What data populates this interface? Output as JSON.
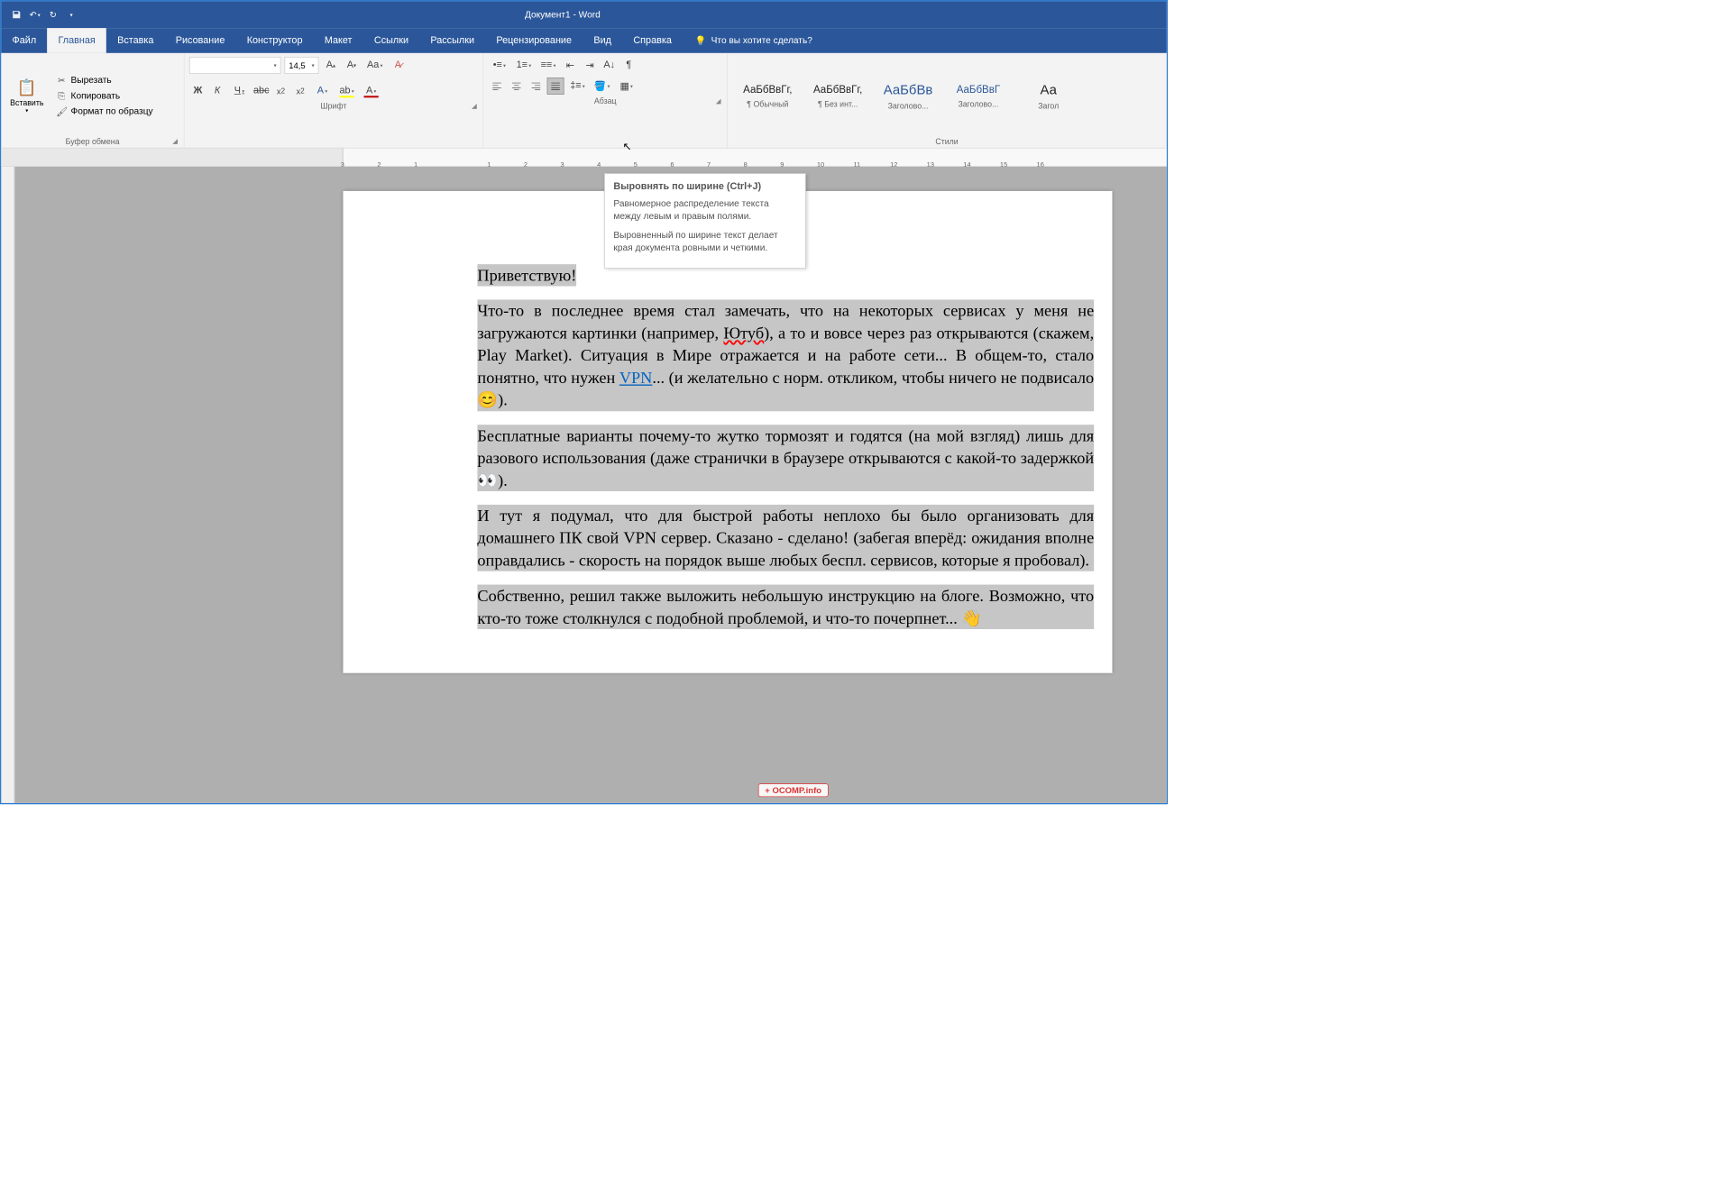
{
  "title": "Документ1  -  Word",
  "tabs": [
    "Файл",
    "Главная",
    "Вставка",
    "Рисование",
    "Конструктор",
    "Макет",
    "Ссылки",
    "Рассылки",
    "Рецензирование",
    "Вид",
    "Справка"
  ],
  "active_tab": 1,
  "tell_me": "Что вы хотите сделать?",
  "clipboard": {
    "paste_label": "Вставить",
    "cut": "Вырезать",
    "copy": "Копировать",
    "format_painter": "Формат по образцу",
    "group": "Буфер обмена"
  },
  "font": {
    "name": "",
    "size": "14,5",
    "group": "Шрифт"
  },
  "paragraph": {
    "group": "Абзац"
  },
  "styles": {
    "group": "Стили",
    "items": [
      {
        "sample": "АаБбВвГг,",
        "name": "¶ Обычный"
      },
      {
        "sample": "АаБбВвГг,",
        "name": "¶ Без инт..."
      },
      {
        "sample": "АаБбВв",
        "name": "Заголово...",
        "link": true,
        "big": true
      },
      {
        "sample": "АаБбВвГ",
        "name": "Заголово...",
        "link": true
      },
      {
        "sample": "Аа",
        "name": "Загол",
        "big": true
      }
    ]
  },
  "tooltip": {
    "title": "Выровнять по ширине (Ctrl+J)",
    "p1": "Равномерное распределение текста между левым и правым полями.",
    "p2": "Выровненный по ширине текст делает края документа ровными и четкими."
  },
  "ruler_neg": [
    "3",
    "2",
    "1"
  ],
  "ruler_pos": [
    "",
    "1",
    "2",
    "3",
    "4",
    "5",
    "6",
    "7",
    "8",
    "9",
    "10",
    "11",
    "12",
    "13",
    "14",
    "15",
    "16"
  ],
  "document": {
    "p1": "Приветствую!",
    "p2a": "Что-то в последнее время стал замечать, что на некоторых сервисах у меня не загружаются картинки (например, ",
    "p2_badword": "Ютуб",
    "p2b": "), а то и вовсе через раз открываются (скажем, Play Market). Ситуация в Мире отражается и на работе сети... В общем-то, стало понятно, что нужен ",
    "p2_link": "VPN",
    "p2c": "... (и желательно с норм. откликом, чтобы ничего не подвисало 😊).",
    "p3": "Бесплатные варианты почему-то жутко тормозят и годятся (на мой взгляд) лишь для разового использования (даже странички в браузере открываются с какой-то задержкой 👀).",
    "p4": "И тут я подумал, что для быстрой работы неплохо бы было организовать для домашнего ПК свой VPN сервер. Сказано - сделано! (забегая вперёд: ожидания вполне оправдались - скорость на порядок выше любых беспл. сервисов, которые я пробовал).",
    "p5": "Собственно, решил также выложить небольшую инструкцию на блоге. Возможно, что кто-то тоже столкнулся с подобной проблемой, и что-то почерпнет... 👋"
  },
  "watermark": "+ OCOMP.info"
}
